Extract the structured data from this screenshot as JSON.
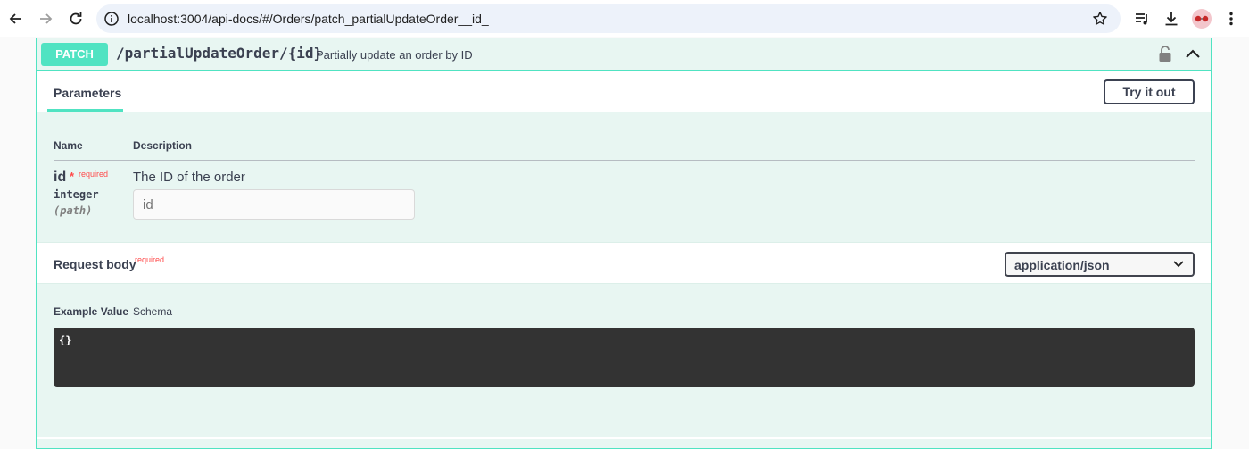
{
  "browser": {
    "url": "localhost:3004/api-docs/#/Orders/patch_partialUpdateOrder__id_"
  },
  "operation": {
    "method": "PATCH",
    "path": "/partialUpdateOrder/{id}",
    "summary": "Partially update an order by ID",
    "accent_color": "#50e3c2"
  },
  "parameters": {
    "tab_label": "Parameters",
    "try_button_label": "Try it out",
    "columns": {
      "name": "Name",
      "description": "Description"
    },
    "items": [
      {
        "name": "id",
        "required_star": "*",
        "required_label": "required",
        "type": "integer",
        "in": "(path)",
        "description": "The ID of the order",
        "placeholder": "id"
      }
    ]
  },
  "request_body": {
    "title": "Request body",
    "required_label": "required",
    "content_type": "application/json",
    "tabs": {
      "example": "Example Value",
      "schema": "Schema"
    },
    "example_code": "{}"
  }
}
